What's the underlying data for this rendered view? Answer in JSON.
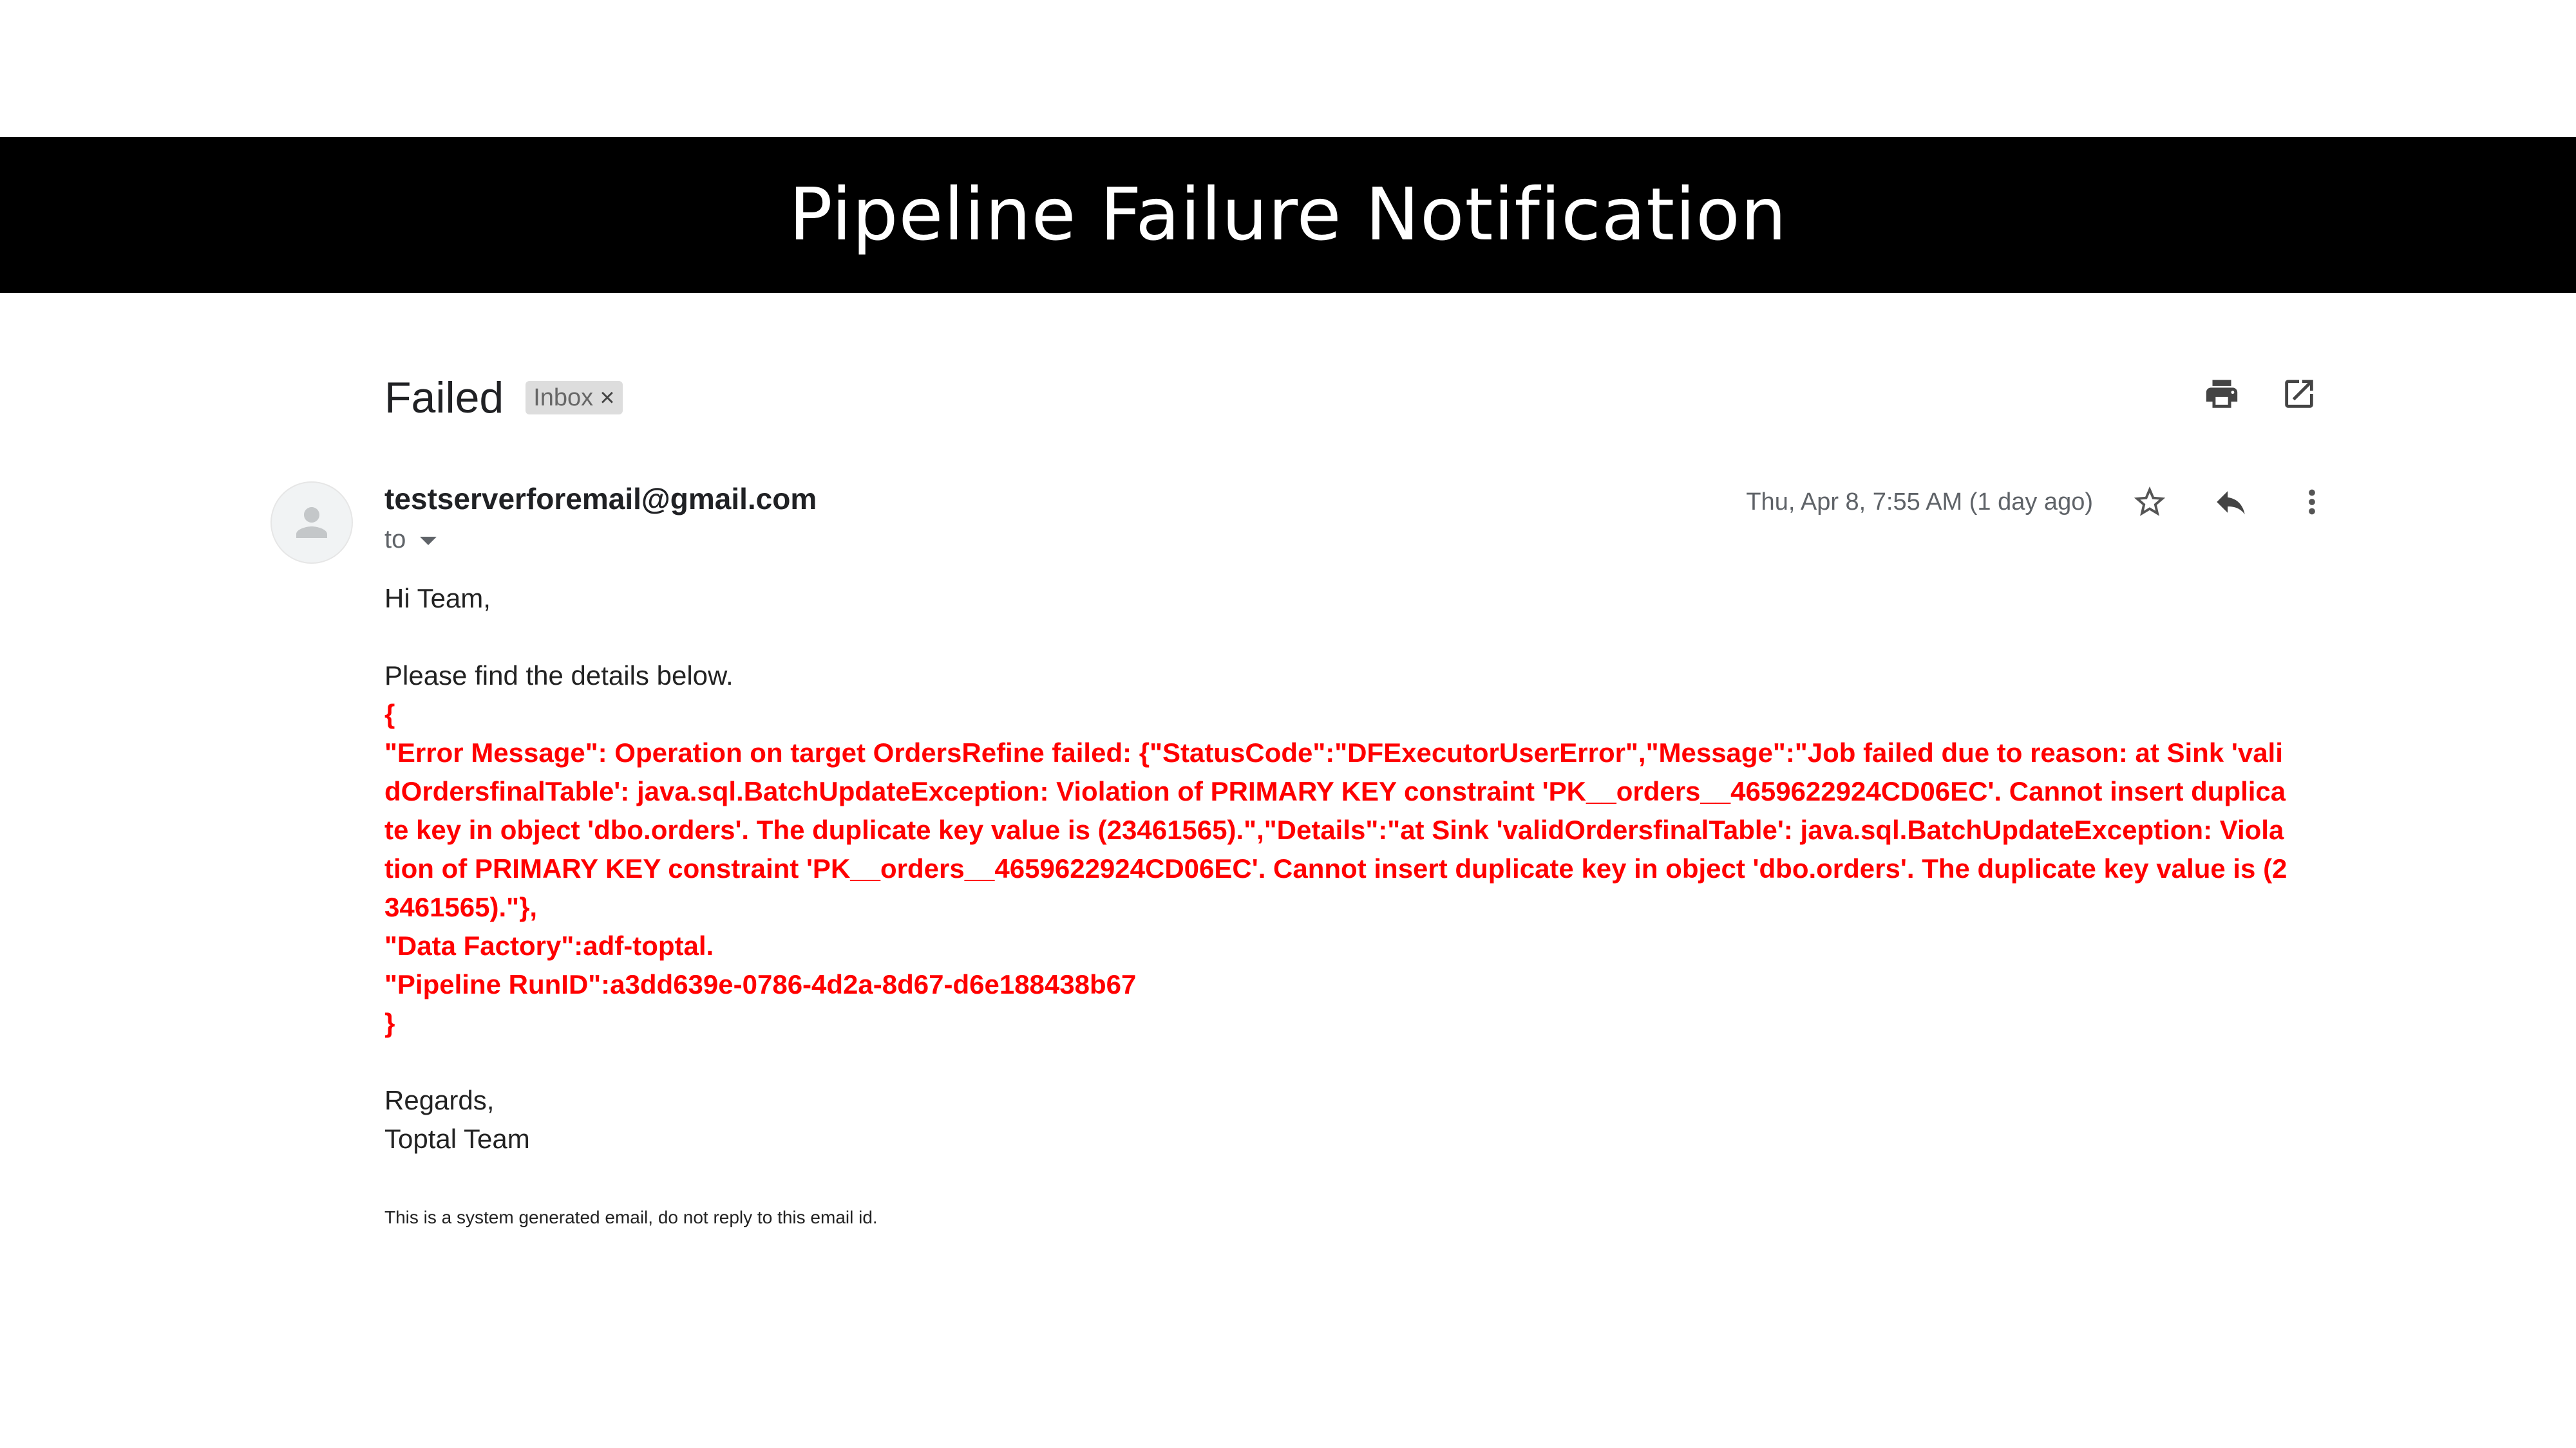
{
  "slide": {
    "title": "Pipeline Failure Notification"
  },
  "email": {
    "subject": "Failed",
    "label": "Inbox",
    "label_remove": "×",
    "sender": "testserverforemail@gmail.com",
    "to_label": "to",
    "date": "Thu, Apr 8, 7:55 AM (1 day ago)",
    "greeting": "Hi Team,",
    "intro": "Please find the details below.",
    "error_open": "{",
    "error_message": "\"Error Message\": Operation on target OrdersRefine failed: {\"StatusCode\":\"DFExecutorUserError\",\"Message\":\"Job failed due to reason: at Sink 'validOrdersfinalTable': java.sql.BatchUpdateException: Violation of PRIMARY KEY constraint 'PK__orders__4659622924CD06EC'. Cannot insert duplicate key in object 'dbo.orders'. The duplicate key value is (23461565).\",\"Details\":\"at Sink 'validOrdersfinalTable': java.sql.BatchUpdateException: Violation of PRIMARY KEY constraint 'PK__orders__4659622924CD06EC'. Cannot insert duplicate key in object 'dbo.orders'. The duplicate key value is (23461565).\"},",
    "data_factory": "\"Data Factory\":adf-toptal.",
    "pipeline_run": "\"Pipeline RunID\":a3dd639e-0786-4d2a-8d67-d6e188438b67",
    "error_close": "}",
    "regards": "Regards,",
    "team": "Toptal Team",
    "footer": "This is a system generated email, do not reply to this email id."
  },
  "icons": {
    "print": "print-icon",
    "open_new": "open-in-new-icon",
    "star": "star-icon",
    "reply": "reply-icon",
    "more": "more-vert-icon",
    "avatar": "person-icon"
  },
  "colors": {
    "title_bar": "#000000",
    "error_text": "#ff0000",
    "label_bg": "#dddddd"
  }
}
